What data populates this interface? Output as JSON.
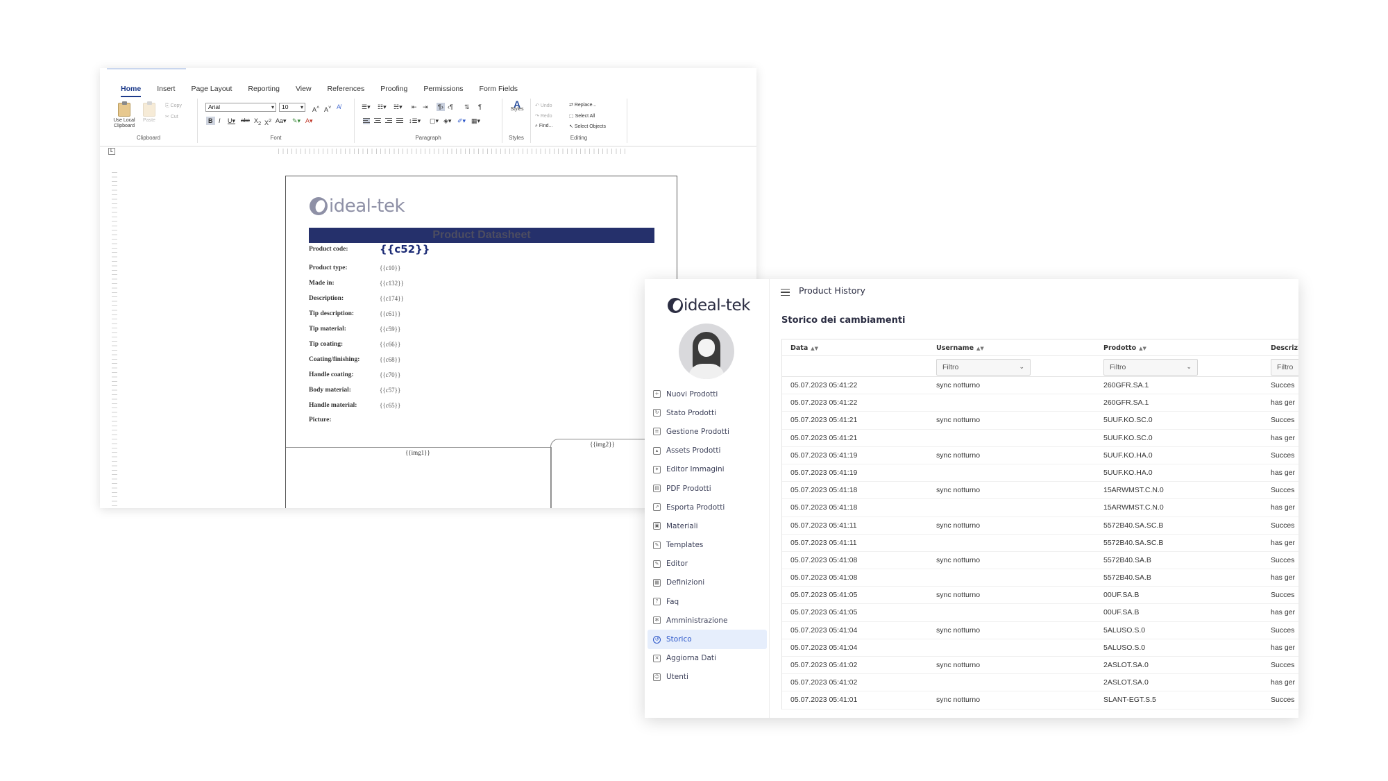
{
  "editor": {
    "ribbon_tabs": [
      "Home",
      "Insert",
      "Page Layout",
      "Reporting",
      "View",
      "References",
      "Proofing",
      "Permissions",
      "Form Fields"
    ],
    "active_tab": "Home",
    "clipboard": {
      "use_local": "Use Local Clipboard",
      "paste": "Paste",
      "copy": "Copy",
      "cut": "Cut",
      "group_label": "Clipboard"
    },
    "font": {
      "family": "Arial",
      "size": "10",
      "group_label": "Font"
    },
    "paragraph": {
      "group_label": "Paragraph"
    },
    "styles": {
      "label": "Styles",
      "group_label": "Styles"
    },
    "editing": {
      "undo": "Undo",
      "redo": "Redo",
      "find": "Find...",
      "replace": "Replace...",
      "select_all": "Select All",
      "select_objects": "Select Objects",
      "group_label": "Editing"
    }
  },
  "document": {
    "logo_text": "ideal-tek",
    "title": "Product Datasheet",
    "fields": [
      {
        "label": "Product code:",
        "value": "{{c52}}"
      },
      {
        "label": "Product type:",
        "value": "{{c10}}"
      },
      {
        "label": "Made in:",
        "value": "{{c132}}"
      },
      {
        "label": "Description:",
        "value": "{{c174}}"
      },
      {
        "label": "Tip description:",
        "value": "{{c61}}"
      },
      {
        "label": "Tip material:",
        "value": "{{c59}}"
      },
      {
        "label": "Tip coating:",
        "value": "{{c66}}"
      },
      {
        "label": "Coating/finishing:",
        "value": "{{c68}}"
      },
      {
        "label": "Handle coating:",
        "value": "{{c70}}"
      },
      {
        "label": "Body material:",
        "value": "{{c57}}"
      },
      {
        "label": "Handle material:",
        "value": "{{c65}}"
      },
      {
        "label": "Picture:",
        "value": ""
      }
    ],
    "img1": "{{img1}}",
    "img2": "{{img2}}"
  },
  "app": {
    "logo_text": "ideal-tek",
    "page_heading": "Product History",
    "section_title": "Storico dei cambiamenti",
    "nav": [
      {
        "label": "Nuovi Prodotti",
        "icon": "file-plus-icon"
      },
      {
        "label": "Stato Prodotti",
        "icon": "refresh-icon"
      },
      {
        "label": "Gestione Prodotti",
        "icon": "file-icon"
      },
      {
        "label": "Assets Prodotti",
        "icon": "image-icon"
      },
      {
        "label": "Editor Immagini",
        "icon": "magic-wand-icon"
      },
      {
        "label": "PDF Prodotti",
        "icon": "pdf-icon"
      },
      {
        "label": "Esporta Prodotti",
        "icon": "export-icon"
      },
      {
        "label": "Materiali",
        "icon": "boxes-icon"
      },
      {
        "label": "Templates",
        "icon": "edit-icon"
      },
      {
        "label": "Editor",
        "icon": "pencil-icon"
      },
      {
        "label": "Definizioni",
        "icon": "calendar-icon"
      },
      {
        "label": "Faq",
        "icon": "question-icon"
      },
      {
        "label": "Amministrazione",
        "icon": "gear-icon"
      },
      {
        "label": "Storico",
        "icon": "history-icon",
        "active": true
      },
      {
        "label": "Aggiorna Dati",
        "icon": "tools-icon"
      },
      {
        "label": "Utenti",
        "icon": "users-icon"
      }
    ],
    "table": {
      "columns": [
        "Data",
        "Username",
        "Prodotto",
        "Descrizi"
      ],
      "filter_placeholder": "Filtro",
      "rows": [
        [
          "05.07.2023 05:41:22",
          "sync notturno",
          "260GFR.SA.1",
          "Succes"
        ],
        [
          "05.07.2023 05:41:22",
          "",
          "260GFR.SA.1",
          "has ger"
        ],
        [
          "05.07.2023 05:41:21",
          "sync notturno",
          "5UUF.KO.SC.0",
          "Succes"
        ],
        [
          "05.07.2023 05:41:21",
          "",
          "5UUF.KO.SC.0",
          "has ger"
        ],
        [
          "05.07.2023 05:41:19",
          "sync notturno",
          "5UUF.KO.HA.0",
          "Succes"
        ],
        [
          "05.07.2023 05:41:19",
          "",
          "5UUF.KO.HA.0",
          "has ger"
        ],
        [
          "05.07.2023 05:41:18",
          "sync notturno",
          "15ARWMST.C.N.0",
          "Succes"
        ],
        [
          "05.07.2023 05:41:18",
          "",
          "15ARWMST.C.N.0",
          "has ger"
        ],
        [
          "05.07.2023 05:41:11",
          "sync notturno",
          "5572B40.SA.SC.B",
          "Succes"
        ],
        [
          "05.07.2023 05:41:11",
          "",
          "5572B40.SA.SC.B",
          "has ger"
        ],
        [
          "05.07.2023 05:41:08",
          "sync notturno",
          "5572B40.SA.B",
          "Succes"
        ],
        [
          "05.07.2023 05:41:08",
          "",
          "5572B40.SA.B",
          "has ger"
        ],
        [
          "05.07.2023 05:41:05",
          "sync notturno",
          "00UF.SA.B",
          "Succes"
        ],
        [
          "05.07.2023 05:41:05",
          "",
          "00UF.SA.B",
          "has ger"
        ],
        [
          "05.07.2023 05:41:04",
          "sync notturno",
          "5ALUSO.S.0",
          "Succes"
        ],
        [
          "05.07.2023 05:41:04",
          "",
          "5ALUSO.S.0",
          "has ger"
        ],
        [
          "05.07.2023 05:41:02",
          "sync notturno",
          "2ASLOT.SA.0",
          "Succes"
        ],
        [
          "05.07.2023 05:41:02",
          "",
          "2ASLOT.SA.0",
          "has ger"
        ],
        [
          "05.07.2023 05:41:01",
          "sync notturno",
          "SLANT-EGT.S.5",
          "Succes"
        ]
      ]
    }
  },
  "colors": {
    "doc_title_bar": "#25306b",
    "accent_blue": "#2a55c8",
    "logo_grey": "#8e90a6"
  }
}
